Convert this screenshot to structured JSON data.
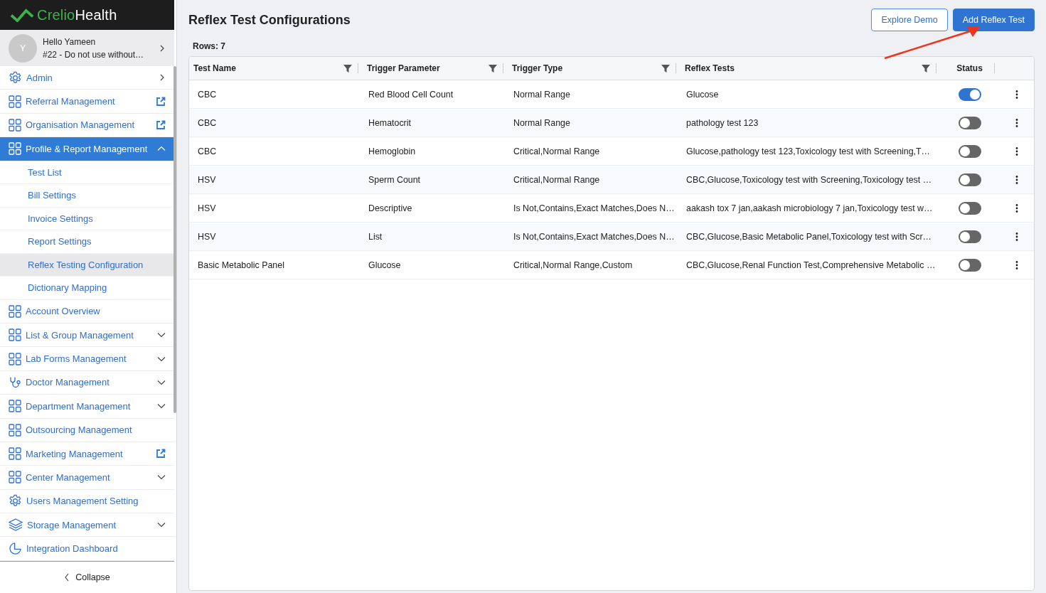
{
  "brand": {
    "first": "Crelio",
    "second": "Health"
  },
  "user": {
    "avatar": "Y",
    "greeting": "Hello Yameen",
    "org": "#22 - Do not use without…"
  },
  "sidebar": {
    "items": [
      {
        "label": "Admin",
        "kind": "gear",
        "submenu": true,
        "external": false,
        "selected": false
      },
      {
        "label": "Referral Management",
        "kind": "grid",
        "submenu": false,
        "external": true,
        "selected": false
      },
      {
        "label": "Organisation Management",
        "kind": "grid",
        "submenu": false,
        "external": true,
        "selected": false
      },
      {
        "label": "Profile & Report Management",
        "kind": "grid",
        "submenu": false,
        "external": false,
        "expanded": true,
        "selected": true,
        "children": [
          {
            "label": "Test List",
            "selected": false
          },
          {
            "label": "Bill Settings",
            "selected": false
          },
          {
            "label": "Invoice Settings",
            "selected": false
          },
          {
            "label": "Report Settings",
            "selected": false
          },
          {
            "label": "Reflex Testing Configuration",
            "selected": true
          },
          {
            "label": "Dictionary Mapping",
            "selected": false
          }
        ]
      },
      {
        "label": "Account Overview",
        "kind": "grid",
        "submenu": false,
        "external": false,
        "selected": false
      },
      {
        "label": "List & Group Management",
        "kind": "grid",
        "submenu": false,
        "external": false,
        "expanded": false,
        "selected": false
      },
      {
        "label": "Lab Forms Management",
        "kind": "grid",
        "submenu": false,
        "external": false,
        "expanded": false,
        "selected": false
      },
      {
        "label": "Doctor Management",
        "kind": "stethoscope",
        "submenu": false,
        "external": false,
        "expanded": false,
        "selected": false
      },
      {
        "label": "Department Management",
        "kind": "grid",
        "submenu": false,
        "external": false,
        "expanded": false,
        "selected": false
      },
      {
        "label": "Outsourcing Management",
        "kind": "grid",
        "submenu": false,
        "external": false,
        "selected": false
      },
      {
        "label": "Marketing Management",
        "kind": "grid",
        "submenu": false,
        "external": true,
        "selected": false
      },
      {
        "label": "Center Management",
        "kind": "grid",
        "submenu": false,
        "external": false,
        "expanded": false,
        "selected": false
      },
      {
        "label": "Users Management Setting",
        "kind": "gear",
        "submenu": false,
        "external": false,
        "selected": false
      },
      {
        "label": "Storage Management",
        "kind": "layers",
        "submenu": false,
        "external": false,
        "expanded": false,
        "selected": false
      },
      {
        "label": "Integration Dashboard",
        "kind": "pie",
        "submenu": false,
        "external": false,
        "selected": false
      }
    ],
    "collapse": "Collapse"
  },
  "page": {
    "title": "Reflex Test Configurations",
    "buttons": [
      {
        "label": "Explore Demo",
        "kind": "outline"
      },
      {
        "label": "Add Reflex Test",
        "kind": "primary"
      }
    ],
    "rows_count": "Rows: 7"
  },
  "table": {
    "columns": [
      {
        "label": "Test Name",
        "filter": true
      },
      {
        "label": "Trigger Parameter",
        "filter": true
      },
      {
        "label": "Trigger Type",
        "filter": true
      },
      {
        "label": "Reflex Tests",
        "filter": true
      },
      {
        "label": "Status",
        "filter": false
      }
    ],
    "rows": [
      {
        "test_name": "CBC",
        "trigger_parameter": "Red Blood Cell Count",
        "trigger_type": "Normal Range",
        "reflex_tests": "Glucose",
        "on": true
      },
      {
        "test_name": "CBC",
        "trigger_parameter": "Hematocrit",
        "trigger_type": "Normal Range",
        "reflex_tests": "pathology test 123",
        "on": false
      },
      {
        "test_name": "CBC",
        "trigger_parameter": "Hemoglobin",
        "trigger_type": "Critical,Normal Range",
        "reflex_tests": "Glucose,pathology test 123,Toxicology test with Screening,T…",
        "on": false
      },
      {
        "test_name": "HSV",
        "trigger_parameter": "Sperm Count",
        "trigger_type": "Critical,Normal Range",
        "reflex_tests": "CBC,Glucose,Toxicology test with Screening,Toxicology test …",
        "on": false
      },
      {
        "test_name": "HSV",
        "trigger_parameter": "Descriptive",
        "trigger_type": "Is Not,Contains,Exact Matches,Does N…",
        "reflex_tests": "aakash tox 7 jan,aakash microbiology 7 jan,Toxicology test w…",
        "on": false
      },
      {
        "test_name": "HSV",
        "trigger_parameter": "List",
        "trigger_type": "Is Not,Contains,Exact Matches,Does N…",
        "reflex_tests": "CBC,Glucose,Basic Metabolic Panel,Toxicology test with Scr…",
        "on": false
      },
      {
        "test_name": "Basic Metabolic Panel",
        "trigger_parameter": "Glucose",
        "trigger_type": "Critical,Normal Range,Custom",
        "reflex_tests": "CBC,Glucose,Renal Function Test,Comprehensive Metabolic …",
        "on": false
      }
    ]
  }
}
